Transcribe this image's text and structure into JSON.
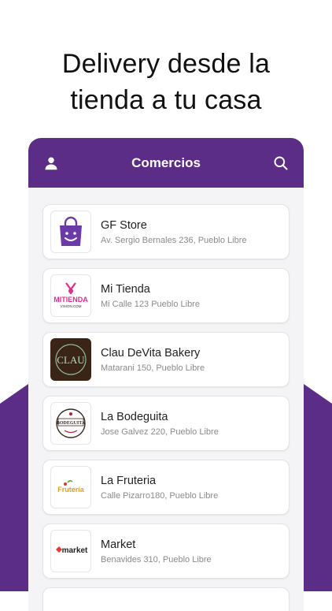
{
  "headline": {
    "line1": "Delivery desde la",
    "line2": "tienda a tu casa"
  },
  "appbar": {
    "title": "Comercios",
    "user_icon": "user-icon",
    "search_icon": "search-icon"
  },
  "stores": [
    {
      "name": "GF Store",
      "address": "Av. Sergio Bernales 236, Pueblo Libre",
      "logo": "bag-smile-icon"
    },
    {
      "name": "Mi Tienda",
      "address": "Mi Calle 123 Pueblo Libre",
      "logo_text": "MITIENDA",
      "logo_sub": "VISION.COM"
    },
    {
      "name": "Clau DeVita Bakery",
      "address": "Matarani 150, Pueblo Libre",
      "logo_text": "CLAU"
    },
    {
      "name": "La Bodeguita",
      "address": "Jose Galvez 220, Pueblo Libre",
      "logo_text": "BODEGUITA"
    },
    {
      "name": "La Fruteria",
      "address": "Calle Pizarro180, Pueblo Libre",
      "logo_text": "Frutería"
    },
    {
      "name": "Market",
      "address": "Benavides 310, Pueblo Libre",
      "logo_text": "market"
    }
  ],
  "colors": {
    "brand": "#5b2d86",
    "background": "#ffffff"
  }
}
